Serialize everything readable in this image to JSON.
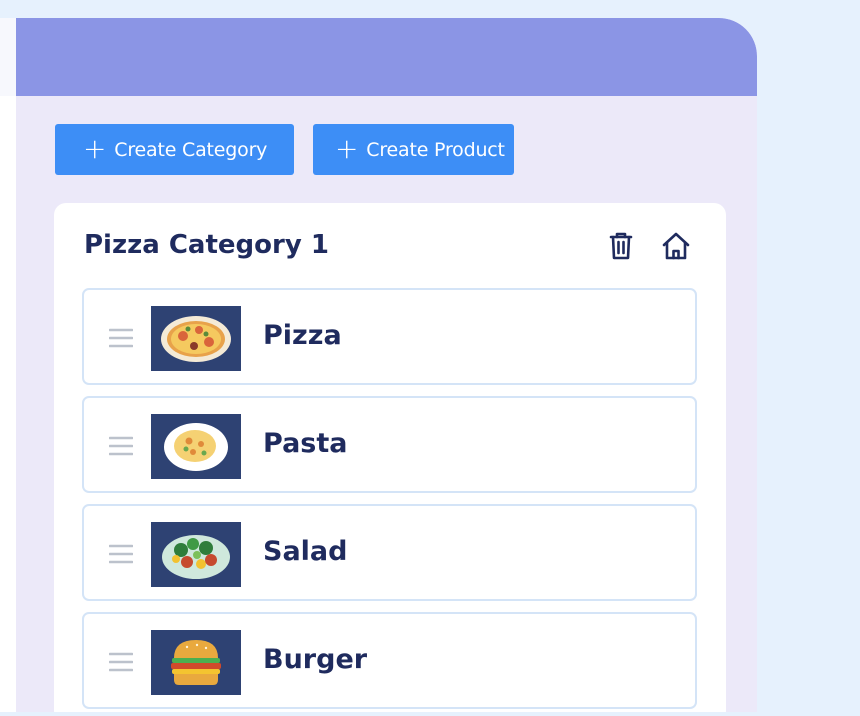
{
  "toolbar": {
    "create_category_label": "Create Category",
    "create_product_label": "Create Product"
  },
  "category": {
    "title": "Pizza Category 1",
    "items": [
      {
        "name": "Pizza",
        "image_icon": "pizza-icon"
      },
      {
        "name": "Pasta",
        "image_icon": "pasta-icon"
      },
      {
        "name": "Salad",
        "image_icon": "salad-icon"
      },
      {
        "name": "Burger",
        "image_icon": "burger-icon"
      }
    ]
  },
  "colors": {
    "page_bg": "#e6f1fd",
    "header": "#8b95e5",
    "panel": "#ece9f9",
    "button": "#3d8ef6",
    "title_text": "#1f2b5e",
    "thumb_bg": "#2e4273",
    "item_border": "#d4e4f7"
  }
}
